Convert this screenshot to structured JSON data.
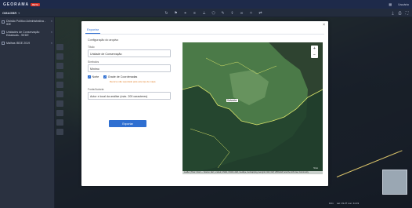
{
  "app": {
    "logo": "GEORAMA",
    "badge": "BETA"
  },
  "topbar": {
    "user": "Usuário",
    "settings_icon": "grid-icon"
  },
  "toolbar": {
    "title": "OMAGBR"
  },
  "sidebar": {
    "layers": [
      {
        "label": "Divisão Político Administrativa - IDE"
      },
      {
        "label": "Unidades de Conservação Estaduais - SEDE"
      },
      {
        "label": "Malhas IBGE 2019"
      }
    ]
  },
  "status": {
    "scale": "10m",
    "coords": "Lat: 19.27 Lon: 41.19"
  },
  "modal": {
    "tab": "Exportar",
    "close": "×",
    "section_title": "Configuração do arquivo",
    "title_label": "Título",
    "title_value": "Unidade de Conservação",
    "symbols_label": "Símbolos",
    "symbols_value": "Mínimo",
    "check_north": "Norte",
    "check_grid": "Grade de Coordenadas",
    "warning": "Recurso não suportado para este tipo de mapa",
    "source_label": "Fonte/Autoria",
    "source_value": "Autor e local da análise (máx. 200 caracteres)",
    "button": "Exportar"
  },
  "map": {
    "zoom_in": "+",
    "zoom_out": "−",
    "city": "Salvador",
    "attribution": "Leaflet | Tiles © Esri — Source: Esri, i-cubed, USDA, USGS, AEX, GeoEye, Getmapping, Aerogrid, IGN, IGP, UPR-EGP, and the GIS User Community",
    "scale": "5 km"
  }
}
